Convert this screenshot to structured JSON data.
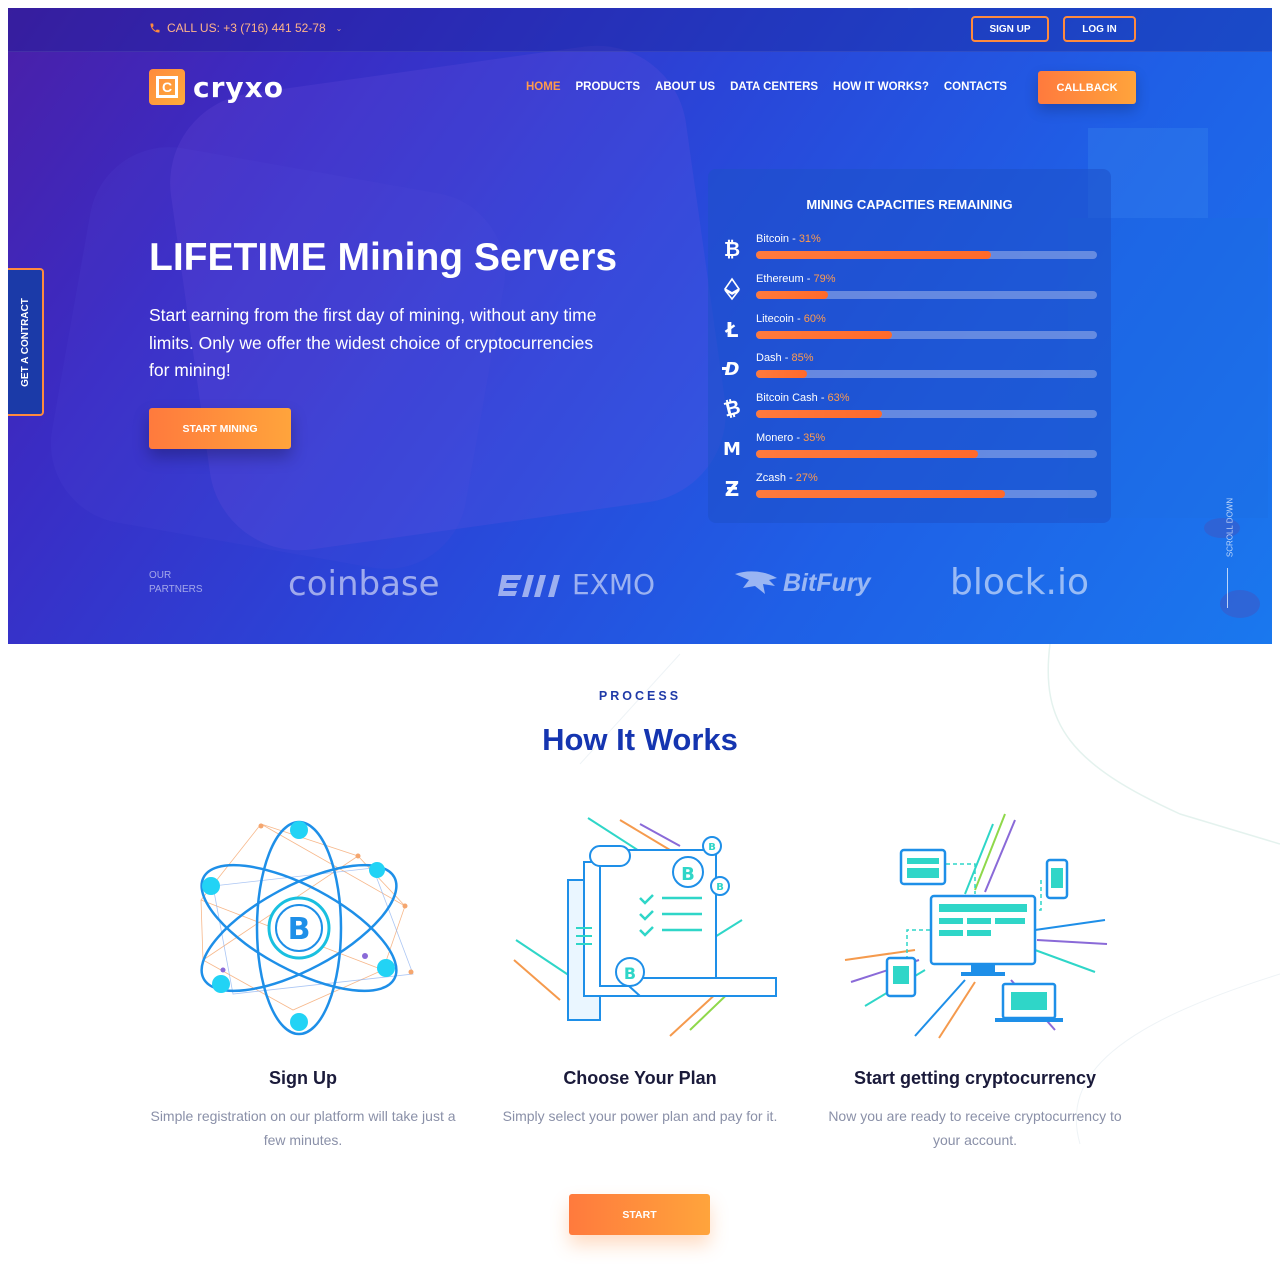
{
  "topbar": {
    "phone_label": "CALL US: +3 (716) 441 52-78",
    "signup": "SIGN UP",
    "login": "LOG IN"
  },
  "logo": {
    "letter": "C",
    "text": "cryxo"
  },
  "nav": {
    "items": [
      "HOME",
      "PRODUCTS",
      "ABOUT US",
      "DATA CENTERS",
      "HOW IT WORKS?",
      "CONTACTS"
    ],
    "active": "HOME",
    "callback": "CALLBACK"
  },
  "side_tab": "GET A CONTRACT",
  "hero": {
    "title": "LIFETIME Mining Servers",
    "subtitle": "Start earning from the first day of mining, without any time limits. Only we offer the widest choice of cryptocurrencies for mining!",
    "cta": "START MINING"
  },
  "mining": {
    "title": "MINING CAPACITIES REMAINING",
    "coins": [
      {
        "name": "Bitcoin",
        "pct_label": "31%",
        "fill": 0.69,
        "icon": "bitcoin-icon"
      },
      {
        "name": "Ethereum",
        "pct_label": "79%",
        "fill": 0.21,
        "icon": "ethereum-icon"
      },
      {
        "name": "Litecoin",
        "pct_label": "60%",
        "fill": 0.4,
        "icon": "litecoin-icon"
      },
      {
        "name": "Dash",
        "pct_label": "85%",
        "fill": 0.15,
        "icon": "dash-icon"
      },
      {
        "name": "Bitcoin Cash",
        "pct_label": "63%",
        "fill": 0.37,
        "icon": "bitcoin-cash-icon"
      },
      {
        "name": "Monero",
        "pct_label": "35%",
        "fill": 0.65,
        "icon": "monero-icon"
      },
      {
        "name": "Zcash",
        "pct_label": "27%",
        "fill": 0.73,
        "icon": "zcash-icon"
      }
    ]
  },
  "partners": {
    "label_line1": "OUR",
    "label_line2": "PARTNERS",
    "names": [
      "coinbase",
      "EXMO",
      "BitFury",
      "block.io"
    ]
  },
  "scroll_down": "SCROLL DOWN",
  "process": {
    "eyebrow": "PROCESS",
    "title": "How It Works",
    "steps": [
      {
        "title": "Sign Up",
        "desc": "Simple registration on our platform will take just a few minutes."
      },
      {
        "title": "Choose Your Plan",
        "desc": "Simply select your power plan and pay for it."
      },
      {
        "title": "Start getting cryptocurrency",
        "desc": "Now you are ready to receive cryptocurrency to your account."
      }
    ],
    "cta": "START"
  },
  "colors": {
    "accent": "#ff8a3d",
    "heading_blue": "#1535b0",
    "hero_blue": "#1f5fe6"
  }
}
